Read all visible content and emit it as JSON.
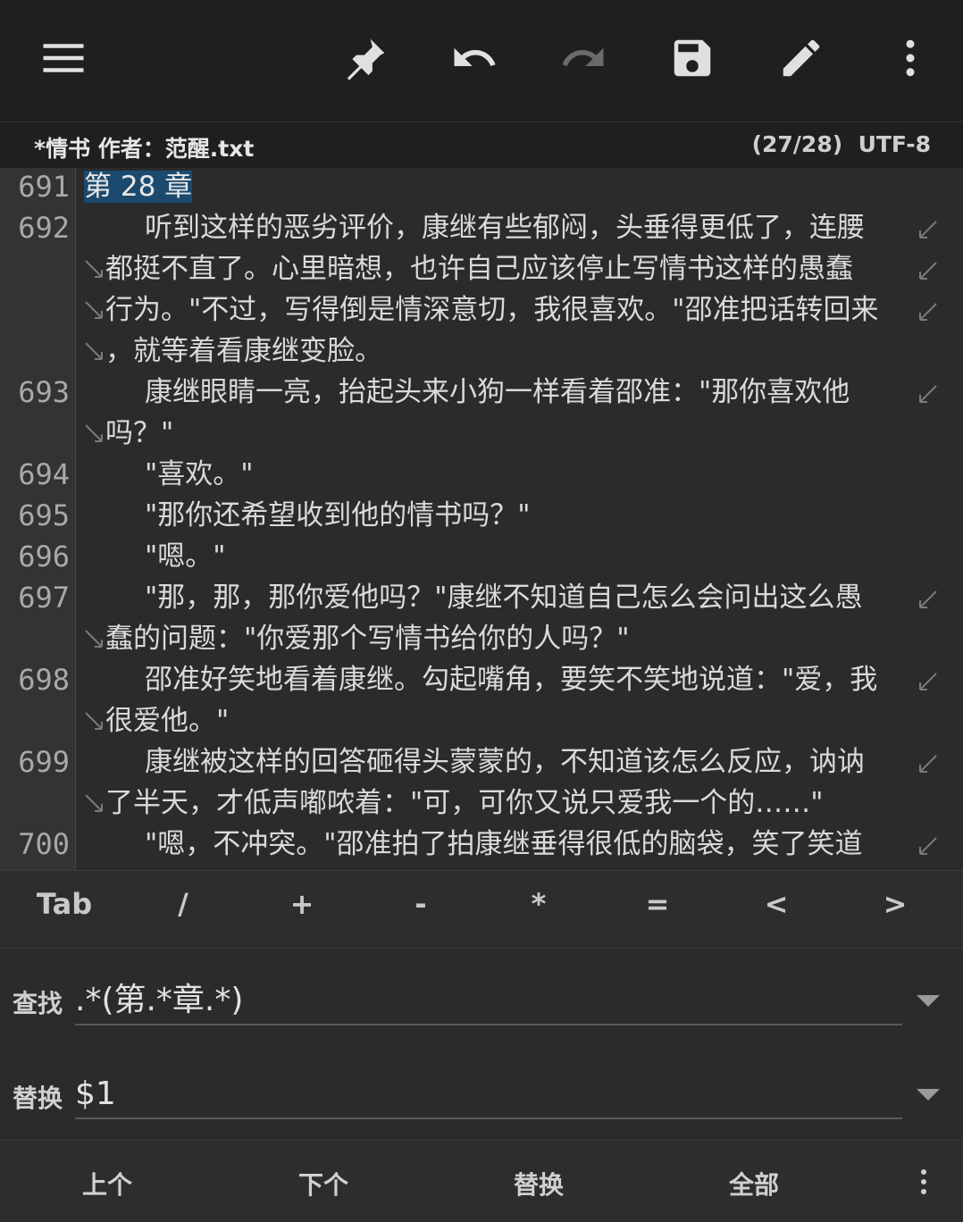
{
  "toolbar": {
    "icons": [
      "menu-icon",
      "pin-icon",
      "undo-icon",
      "redo-icon",
      "save-icon",
      "edit-icon",
      "more-vert-icon"
    ]
  },
  "file": {
    "name": "*情书 作者：范醒.txt",
    "position": "(27/28)",
    "encoding": "UTF-8"
  },
  "editor": {
    "line_numbers": [
      "691",
      "692",
      "693",
      "694",
      "695",
      "696",
      "697",
      "698",
      "699",
      "700"
    ],
    "lines": [
      {
        "no": "691",
        "rows": [
          "第 28 章"
        ],
        "highlight": true
      },
      {
        "no": "692",
        "rows": [
          "听到这样的恶劣评价，康继有些郁闷，头垂得更低了，连腰",
          "都挺不直了。心里暗想，也许自己应该停止写情书这样的愚蠢",
          "行为。\"不过，写得倒是情深意切，我很喜欢。\"邵准把话转回来",
          "，就等着看康继变脸。"
        ]
      },
      {
        "no": "693",
        "rows": [
          "康继眼睛一亮，抬起头来小狗一样看着邵准：\"那你喜欢他",
          "吗？\""
        ]
      },
      {
        "no": "694",
        "rows": [
          "\"喜欢。\""
        ]
      },
      {
        "no": "695",
        "rows": [
          "\"那你还希望收到他的情书吗？\""
        ]
      },
      {
        "no": "696",
        "rows": [
          "\"嗯。\""
        ]
      },
      {
        "no": "697",
        "rows": [
          "\"那，那，那你爱他吗？\"康继不知道自己怎么会问出这么愚",
          "蠢的问题：\"你爱那个写情书给你的人吗？\""
        ]
      },
      {
        "no": "698",
        "rows": [
          "邵准好笑地看着康继。勾起嘴角，要笑不笑地说道：\"爱，我",
          "很爱他。\""
        ]
      },
      {
        "no": "699",
        "rows": [
          "康继被这样的回答砸得头蒙蒙的，不知道该怎么反应，讷讷",
          "了半天，才低声嘟哝着：\"可，可你又说只爱我一个的……\""
        ]
      },
      {
        "no": "700",
        "rows": [
          "\"嗯，不冲突。\"邵准拍了拍康继垂得很低的脑袋，笑了笑道"
        ]
      }
    ]
  },
  "symbols": [
    "Tab",
    "/",
    "+",
    "-",
    "*",
    "=",
    "<",
    ">"
  ],
  "find": {
    "label": "查找",
    "value": ".*(第.*章.*)"
  },
  "replace": {
    "label": "替换",
    "value": "$1"
  },
  "actions": {
    "prev": "上个",
    "next": "下个",
    "replace": "替换",
    "all": "全部"
  }
}
